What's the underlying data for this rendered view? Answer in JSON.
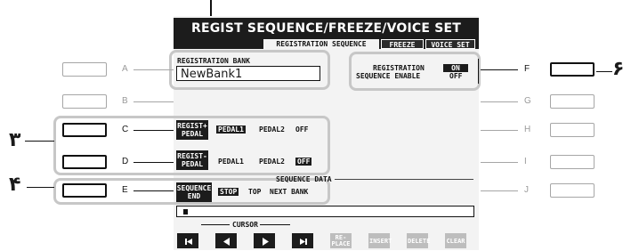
{
  "screen": {
    "title": "REGIST SEQUENCE/FREEZE/VOICE SET",
    "tabs": [
      {
        "label": "REGISTRATION SEQUENCE",
        "active": true
      },
      {
        "label": "FREEZE",
        "active": false
      },
      {
        "label": "VOICE SET",
        "active": false
      }
    ],
    "bank_label": "REGISTRATION BANK",
    "bank_value": "NewBank1",
    "enable_label_1": "REGISTRATION",
    "enable_label_2": "SEQUENCE ENABLE",
    "enable_on": "ON",
    "enable_off": "OFF",
    "c_row": {
      "tag_1": "REGIST+",
      "tag_2": "PEDAL",
      "opt_1": "PEDAL1",
      "opt_2": "PEDAL2",
      "opt_3": "OFF"
    },
    "d_row": {
      "tag_1": "REGIST-",
      "tag_2": "PEDAL",
      "opt_1": "PEDAL1",
      "opt_2": "PEDAL2",
      "opt_3": "OFF"
    },
    "e_row": {
      "tag_1": "SEQUENCE",
      "tag_2": "END",
      "opt_1": "STOP",
      "opt_2": "TOP",
      "opt_3": "NEXT BANK"
    },
    "sequence_data_label": "SEQUENCE DATA",
    "cursor_label": "CURSOR",
    "nav_buttons": [
      {
        "label": "",
        "icon": "skip-to-start-icon"
      },
      {
        "label": "",
        "icon": "left-arrow-icon"
      },
      {
        "label": "",
        "icon": "right-arrow-icon"
      },
      {
        "label": "",
        "icon": "skip-to-end-icon"
      },
      {
        "label": "RE-\nPLACE",
        "icon": ""
      },
      {
        "label": "INSERT",
        "icon": ""
      },
      {
        "label": "DELETE",
        "icon": ""
      },
      {
        "label": "CLEAR",
        "icon": ""
      }
    ]
  },
  "left_letters": [
    "A",
    "B",
    "C",
    "D",
    "E"
  ],
  "right_letters": [
    "F",
    "G",
    "H",
    "I",
    "J"
  ],
  "callouts": {
    "left_upper": "٣",
    "left_lower": "۴",
    "right": "۶"
  }
}
